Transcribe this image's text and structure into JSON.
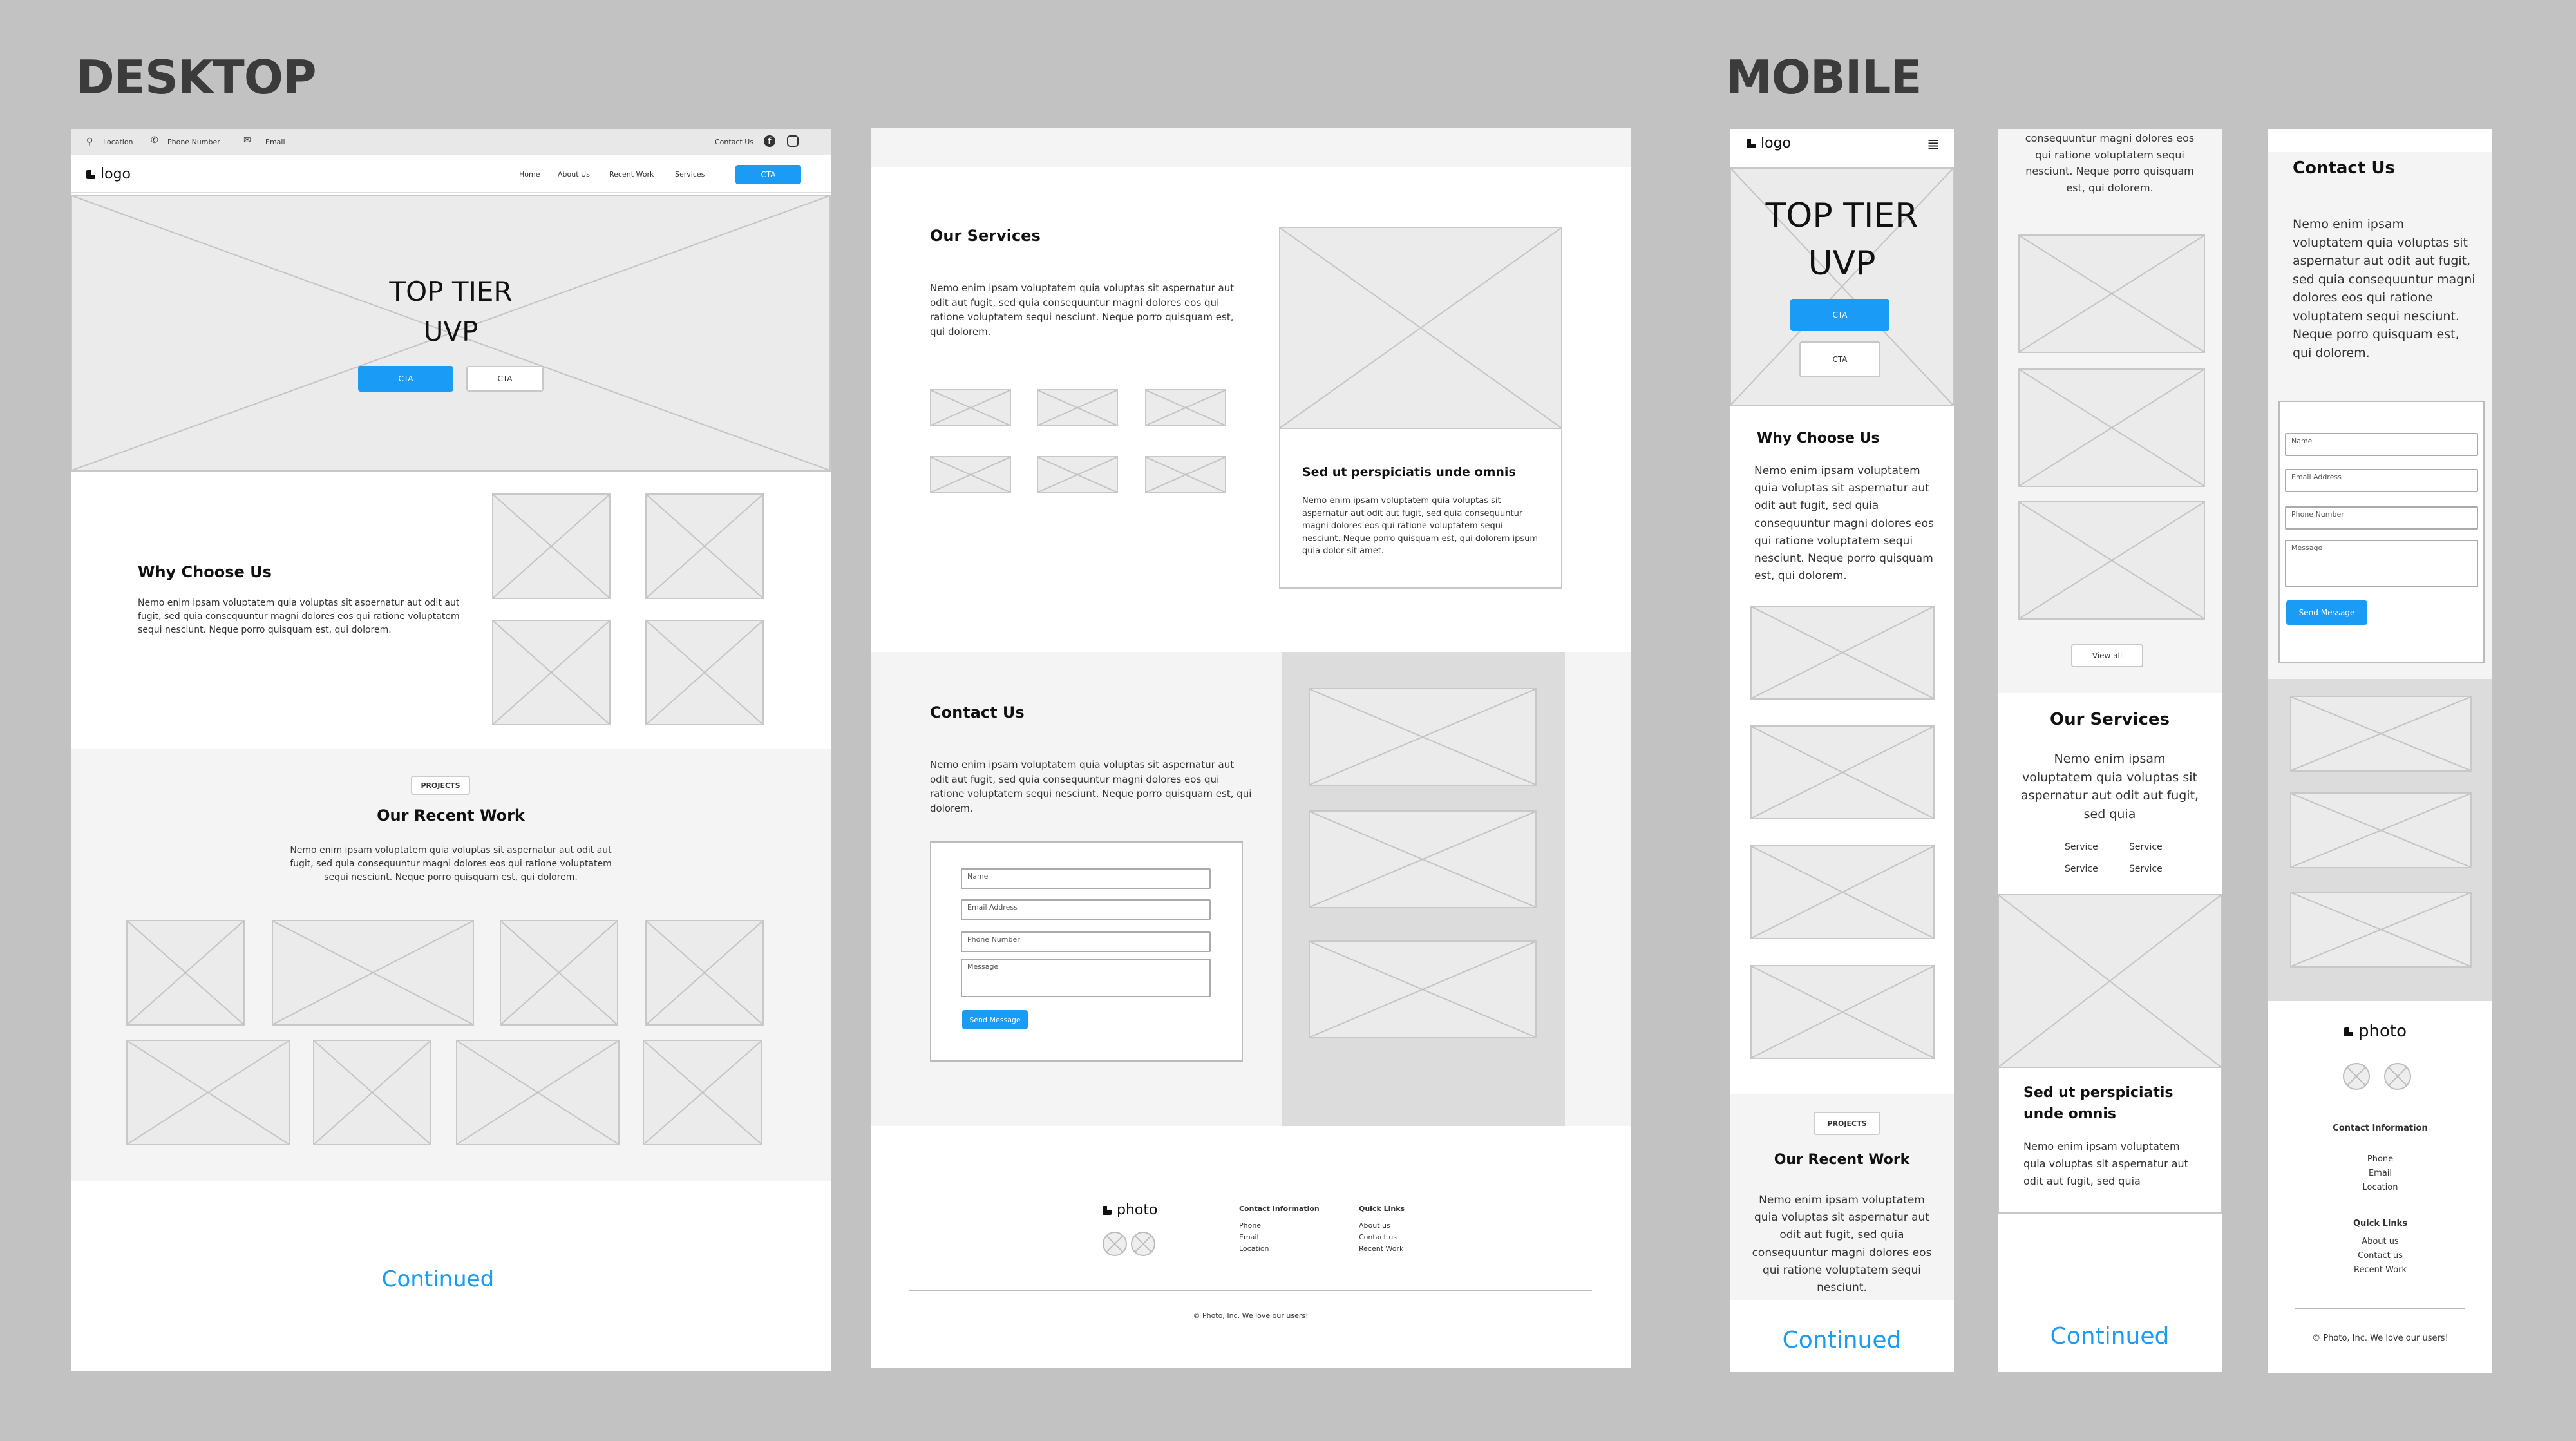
{
  "headings": {
    "desktop": "DESKTOP",
    "mobile": "MOBILE"
  },
  "desktop1": {
    "topbar": {
      "location": "Location",
      "phone": "Phone Number",
      "email": "Email",
      "contact": "Contact Us"
    },
    "nav": {
      "logo": "logo",
      "items": [
        "Home",
        "About Us",
        "Recent Work",
        "Services"
      ],
      "cta": "CTA"
    },
    "hero": {
      "line1": "TOP TIER",
      "line2": "UVP",
      "cta": "CTA",
      "cta2": "CTA"
    },
    "why": {
      "title": "Why Choose Us",
      "body": "Nemo enim ipsam voluptatem quia voluptas sit aspernatur aut odit aut fugit, sed quia consequuntur magni dolores eos qui ratione voluptatem sequi nesciunt. Neque porro quisquam est, qui dolorem."
    },
    "projects": {
      "tag": "PROJECTS",
      "title": "Our Recent Work",
      "body": "Nemo enim ipsam voluptatem quia voluptas sit aspernatur aut odit aut fugit, sed quia consequuntur magni dolores eos qui ratione voluptatem sequi nesciunt. Neque porro quisquam est, qui dolorem."
    },
    "continued": "Continued"
  },
  "desktop2": {
    "services": {
      "title": "Our Services",
      "body": "Nemo enim ipsam voluptatem quia voluptas sit aspernatur aut odit aut fugit, sed quia consequuntur magni dolores eos qui ratione voluptatem sequi nesciunt. Neque porro quisquam est, qui dolorem.",
      "card_title": "Sed ut perspiciatis unde omnis",
      "card_body": "Nemo enim ipsam voluptatem quia voluptas sit aspernatur aut odit aut fugit, sed quia consequuntur magni dolores eos qui ratione voluptatem sequi nesciunt. Neque porro quisquam est, qui dolorem ipsum quia dolor sit amet."
    },
    "contact": {
      "title": "Contact Us",
      "body": "Nemo enim ipsam voluptatem quia voluptas sit aspernatur aut odit aut fugit, sed quia consequuntur magni dolores eos qui ratione voluptatem sequi nesciunt. Neque porro quisquam est, qui dolorem.",
      "name": "Name",
      "email": "Email Address",
      "phone": "Phone Number",
      "message": "Message",
      "send": "Send Message"
    },
    "footer": {
      "logo": "photo",
      "info_title": "Contact Information",
      "info": [
        "Phone",
        "Email",
        "Location"
      ],
      "links_title": "Quick Links",
      "links": [
        "About us",
        "Contact us",
        "Recent Work"
      ],
      "copyright": "© Photo, Inc. We love our users!"
    }
  },
  "mobile1": {
    "logo": "logo",
    "hero": {
      "line1": "TOP TIER",
      "line2": "UVP",
      "cta": "CTA",
      "cta2": "CTA"
    },
    "why": {
      "title": "Why Choose Us",
      "body": "Nemo enim ipsam voluptatem quia voluptas sit aspernatur aut odit aut fugit, sed quia consequuntur magni dolores eos qui ratione voluptatem sequi nesciunt. Neque porro quisquam est, qui dolorem."
    },
    "projects": {
      "tag": "PROJECTS",
      "title": "Our Recent Work",
      "body": "Nemo enim ipsam voluptatem quia voluptas sit aspernatur aut odit aut fugit, sed quia consequuntur magni dolores eos qui ratione voluptatem sequi nesciunt."
    },
    "continued": "Continued"
  },
  "mobile2": {
    "top_text": "consequuntur magni dolores eos qui ratione voluptatem sequi nesciunt. Neque porro quisquam est, qui dolorem.",
    "view_all": "View all",
    "services": {
      "title": "Our Services",
      "body": "Nemo enim ipsam voluptatem quia voluptas sit aspernatur aut odit aut fugit, sed quia",
      "links": [
        "Service",
        "Service",
        "Service",
        "Service"
      ]
    },
    "card": {
      "title": "Sed ut perspiciatis unde omnis",
      "body": "Nemo enim ipsam voluptatem quia voluptas sit aspernatur aut odit aut fugit, sed quia"
    },
    "continued": "Continued"
  },
  "mobile3": {
    "contact": {
      "title": "Contact Us",
      "body": "Nemo enim ipsam voluptatem quia voluptas sit aspernatur aut odit aut fugit, sed quia consequuntur magni dolores eos qui ratione voluptatem sequi nesciunt. Neque porro quisquam est, qui dolorem.",
      "name": "Name",
      "email": "Email Address",
      "phone": "Phone Number",
      "message": "Message",
      "send": "Send Message"
    },
    "footer": {
      "logo": "photo",
      "info_title": "Contact Information",
      "info": [
        "Phone",
        "Email",
        "Location"
      ],
      "links_title": "Quick Links",
      "links": [
        "About us",
        "Contact us",
        "Recent Work"
      ],
      "copyright": "© Photo, Inc. We love our users!"
    }
  }
}
